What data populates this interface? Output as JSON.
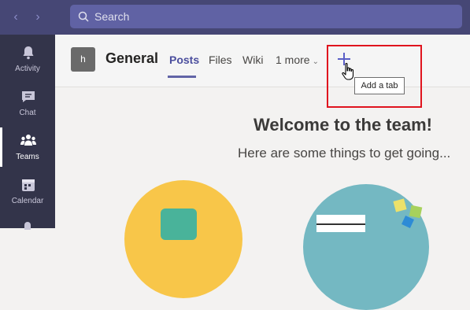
{
  "search": {
    "placeholder": "Search"
  },
  "rail": {
    "items": [
      {
        "label": "Activity",
        "icon": "bell-icon"
      },
      {
        "label": "Chat",
        "icon": "chat-icon"
      },
      {
        "label": "Teams",
        "icon": "teams-icon",
        "active": true
      },
      {
        "label": "Calendar",
        "icon": "calendar-icon"
      }
    ]
  },
  "channel": {
    "avatar_letter": "h",
    "title": "General",
    "tabs": [
      {
        "label": "Posts",
        "active": true
      },
      {
        "label": "Files"
      },
      {
        "label": "Wiki"
      },
      {
        "label": "1 more"
      }
    ],
    "add_tab_tooltip": "Add a tab"
  },
  "main": {
    "welcome_title": "Welcome to the team!",
    "welcome_subtitle": "Here are some things to get going..."
  },
  "colors": {
    "topbar": "#464775",
    "rail": "#33344a",
    "accent": "#6264a7",
    "highlight": "#e0141e"
  }
}
